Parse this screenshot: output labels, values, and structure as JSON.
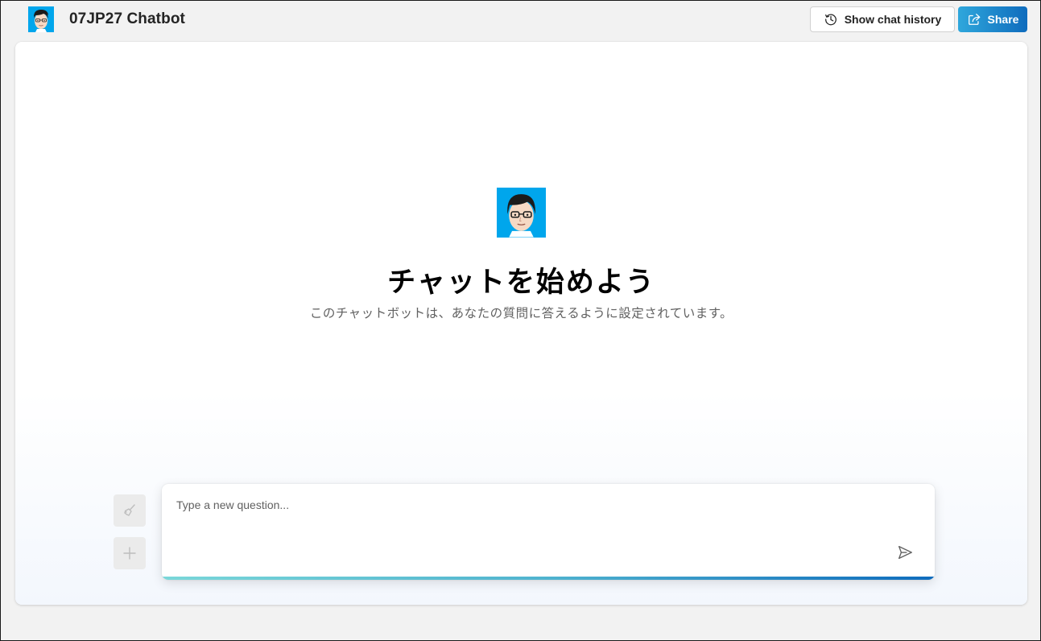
{
  "header": {
    "title": "07JP27 Chatbot",
    "logo_icon": "user-avatar-icon",
    "history_button_label": "Show chat history",
    "history_icon": "history-icon",
    "share_button_label": "Share",
    "share_icon": "share-icon"
  },
  "hero": {
    "avatar_icon": "user-avatar-icon",
    "title": "チャットを始めよう",
    "subtitle": "このチャットボットは、あなたの質問に答えるように設定されています。"
  },
  "composer": {
    "placeholder": "Type a new question...",
    "value": "",
    "clear_icon": "broom-icon",
    "new_chat_icon": "plus-icon",
    "send_icon": "send-icon"
  },
  "colors": {
    "avatar_background": "#00a6ec",
    "accent_start": "#2fa7dc",
    "accent_end": "#0f6cbd",
    "page_background": "#f2f2f2"
  }
}
